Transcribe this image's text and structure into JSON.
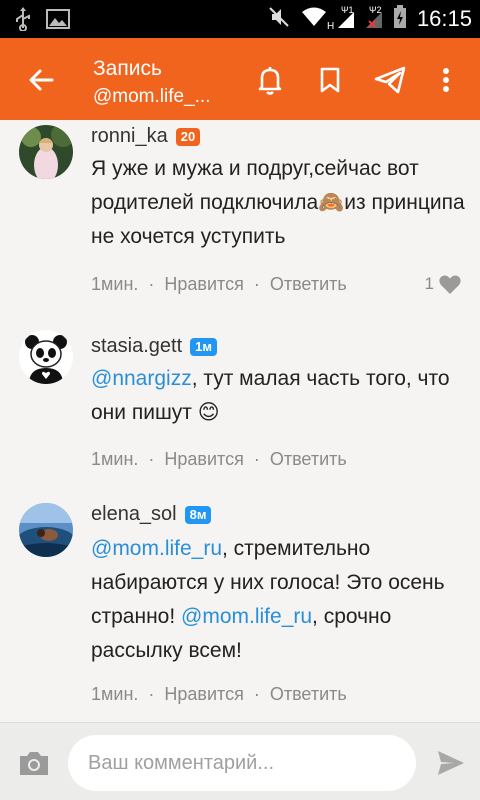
{
  "status_bar": {
    "time": "16:15",
    "sim1": "Ψ1",
    "sim2": "Ψ2",
    "h_label": "H"
  },
  "header": {
    "title": "Запись",
    "subtitle": "@mom.life_..."
  },
  "comments": [
    {
      "username": "ronni_ka",
      "badge": "20",
      "text": "Я уже и мужа и подруг,сейчас вот родителей подключила🙈из принципа не хочется уступить",
      "time": "1мин.",
      "like_label": "Нравится",
      "reply_label": "Ответить",
      "likes": "1"
    },
    {
      "username": "stasia.gett",
      "badge": "1м",
      "mention": "@nnargizz",
      "text": ", тут малая часть того, что они пишут 😊",
      "time": "1мин.",
      "like_label": "Нравится",
      "reply_label": "Ответить"
    },
    {
      "username": "elena_sol",
      "badge": "8м",
      "mention1": "@mom.life_ru",
      "text1": ",  стремительно набираются у них голоса! Это осень странно! ",
      "mention2": "@mom.life_ru",
      "text2": ", срочно рассылку всем!",
      "time": "1мин.",
      "like_label": "Нравится",
      "reply_label": "Ответить"
    }
  ],
  "composer": {
    "placeholder": "Ваш комментарий..."
  },
  "colors": {
    "accent": "#f0641e",
    "mention": "#2a8fd8",
    "badge_blue": "#2196f3"
  }
}
